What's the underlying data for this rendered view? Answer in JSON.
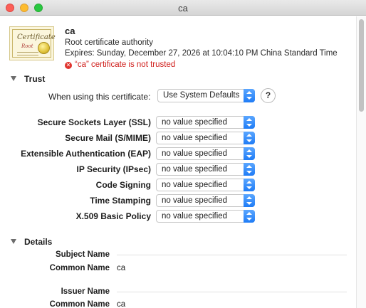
{
  "window": {
    "title": "ca"
  },
  "certificate": {
    "icon_text": "Certificate",
    "icon_subtext": "Root",
    "name": "ca",
    "type": "Root certificate authority",
    "expires": "Expires: Sunday, December 27, 2026 at 10:04:10 PM China Standard Time",
    "warning": "“ca” certificate is not trusted",
    "warning_icon": "error-x-icon"
  },
  "trust": {
    "title": "Trust",
    "using_label": "When using this certificate:",
    "using_value": "Use System Defaults",
    "help_label": "?",
    "policies": [
      {
        "label": "Secure Sockets Layer (SSL)",
        "value": "no value specified"
      },
      {
        "label": "Secure Mail (S/MIME)",
        "value": "no value specified"
      },
      {
        "label": "Extensible Authentication (EAP)",
        "value": "no value specified"
      },
      {
        "label": "IP Security (IPsec)",
        "value": "no value specified"
      },
      {
        "label": "Code Signing",
        "value": "no value specified"
      },
      {
        "label": "Time Stamping",
        "value": "no value specified"
      },
      {
        "label": "X.509 Basic Policy",
        "value": "no value specified"
      }
    ]
  },
  "details": {
    "title": "Details",
    "subject_header": "Subject Name",
    "subject_common_label": "Common Name",
    "subject_common_value": "ca",
    "issuer_header": "Issuer Name",
    "issuer_common_label": "Common Name",
    "issuer_common_value": "ca"
  },
  "colors": {
    "warning": "#d0201d",
    "accent": "#1f7cf6"
  }
}
